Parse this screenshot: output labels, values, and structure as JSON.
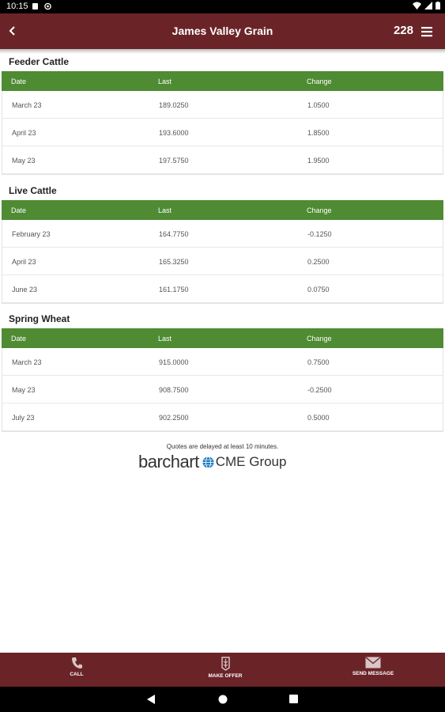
{
  "status_bar": {
    "time": "10:15"
  },
  "app_bar": {
    "title": "James Valley Grain",
    "count": "228"
  },
  "sections": [
    {
      "title": "Feeder Cattle",
      "headers": {
        "date": "Date",
        "last": "Last",
        "change": "Change"
      },
      "rows": [
        {
          "date": "March 23",
          "last": "189.0250",
          "change": "1.0500"
        },
        {
          "date": "April 23",
          "last": "193.6000",
          "change": "1.8500"
        },
        {
          "date": "May 23",
          "last": "197.5750",
          "change": "1.9500"
        }
      ]
    },
    {
      "title": "Live Cattle",
      "headers": {
        "date": "Date",
        "last": "Last",
        "change": "Change"
      },
      "rows": [
        {
          "date": "February 23",
          "last": "164.7750",
          "change": "-0.1250"
        },
        {
          "date": "April 23",
          "last": "165.3250",
          "change": "0.2500"
        },
        {
          "date": "June 23",
          "last": "161.1750",
          "change": "0.0750"
        }
      ]
    },
    {
      "title": "Spring Wheat",
      "headers": {
        "date": "Date",
        "last": "Last",
        "change": "Change"
      },
      "rows": [
        {
          "date": "March 23",
          "last": "915.0000",
          "change": "0.7500"
        },
        {
          "date": "May 23",
          "last": "908.7500",
          "change": "-0.2500"
        },
        {
          "date": "July 23",
          "last": "902.2500",
          "change": "0.5000"
        }
      ]
    }
  ],
  "footer": {
    "delay_note": "Quotes are delayed at least 10 minutes.",
    "barchart_logo": "barchart",
    "cme_logo": "CME Group"
  },
  "bottom_nav": {
    "call": "CALL",
    "make_offer": "MAKE OFFER",
    "send_message": "SEND MESSAGE"
  },
  "colors": {
    "app_bar": "#6a2428",
    "table_header": "#4e8b32"
  },
  "icons": [
    "back-arrow-icon",
    "menu-icon",
    "phone-icon",
    "offer-icon",
    "mail-icon",
    "globe-icon"
  ]
}
